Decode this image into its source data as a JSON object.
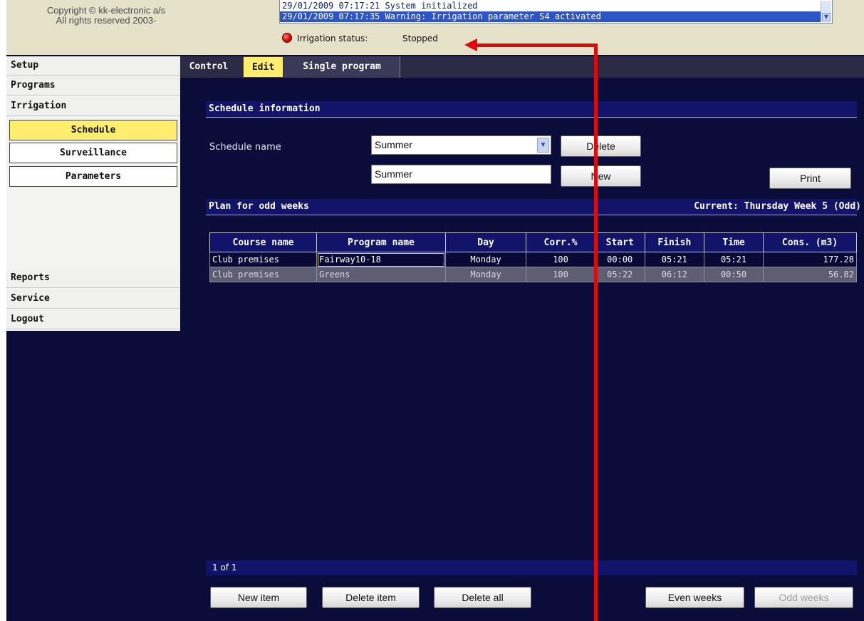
{
  "header": {
    "copyright": "Copyright © kk-electronic a/s\nAll rights reserved 2003-",
    "log": [
      "29/01/2009 07:17:21 System initialized",
      "29/01/2009 07:17:35 Warning: Irrigation parameter S4 activated"
    ],
    "status_label": "Irrigation status:",
    "status_value": "Stopped",
    "status_color": "#e0150f"
  },
  "sidebar": {
    "items": [
      {
        "label": "Setup"
      },
      {
        "label": "Programs"
      },
      {
        "label": "Irrigation"
      }
    ],
    "subitems": [
      {
        "label": "Schedule"
      },
      {
        "label": "Surveillance"
      },
      {
        "label": "Parameters"
      }
    ],
    "bottom_items": [
      {
        "label": "Reports"
      },
      {
        "label": "Service"
      },
      {
        "label": "Logout"
      }
    ],
    "active_color": "#ffed6e"
  },
  "tabs": [
    {
      "label": "Control"
    },
    {
      "label": "Edit"
    },
    {
      "label": "Single program"
    }
  ],
  "schedule": {
    "section_title": "Schedule information",
    "name_label": "Schedule name",
    "selected": "Summer",
    "name_value": "Summer",
    "delete_label": "Delete",
    "new_label": "New",
    "print_label": "Print"
  },
  "plan": {
    "title": "Plan for odd weeks",
    "current": "Current: Thursday Week 5 (Odd)",
    "columns": [
      "Course name",
      "Program name",
      "Day",
      "Corr.%",
      "Start",
      "Finish",
      "Time",
      "Cons. (m3)"
    ],
    "rows": [
      {
        "course": "Club premises",
        "program": "Fairway10-18",
        "day": "Monday",
        "corr": "100",
        "start": "00:00",
        "finish": "05:21",
        "time": "05:21",
        "cons": "177.28"
      },
      {
        "course": "Club premises",
        "program": "Greens",
        "day": "Monday",
        "corr": "100",
        "start": "05:22",
        "finish": "06:12",
        "time": "00:50",
        "cons": "56.82"
      }
    ],
    "pager": "1 of 1"
  },
  "footer": {
    "new_item": "New item",
    "delete_item": "Delete item",
    "delete_all": "Delete all",
    "even_weeks": "Even weeks",
    "odd_weeks": "Odd weeks"
  }
}
